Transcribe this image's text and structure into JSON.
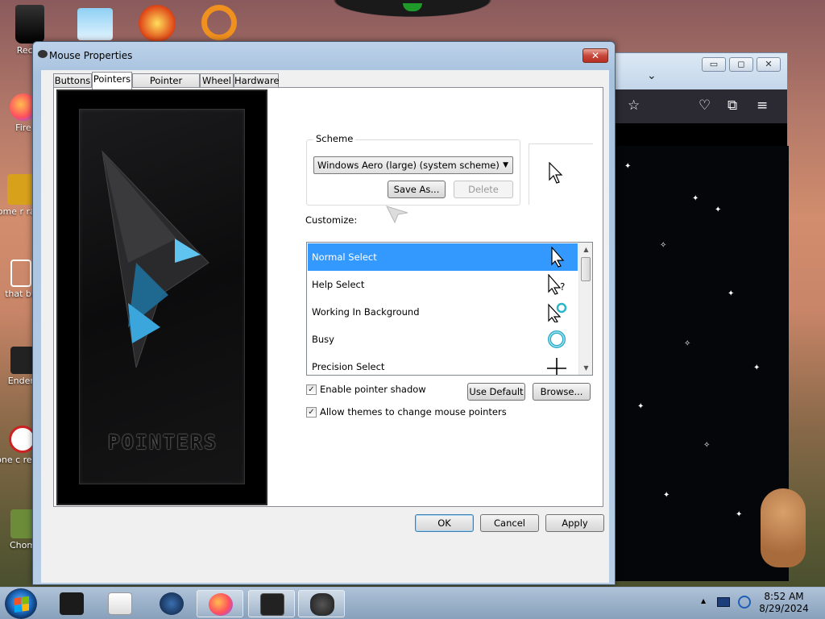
{
  "desktop": {
    "icons": [
      {
        "label": "Recyc",
        "icon": "recycle-bin-icon"
      },
      {
        "label": "Fire",
        "icon": "firefox-icon"
      },
      {
        "label": "some r ran a",
        "icon": "app-icon"
      },
      {
        "label": "that bu",
        "icon": "clipboard-icon"
      },
      {
        "label": "Enderr",
        "icon": "app-icon"
      },
      {
        "label": "none c retards",
        "icon": "app-icon"
      },
      {
        "label": "Chom",
        "icon": "app-icon"
      }
    ]
  },
  "browser": {
    "min_glyph": "▭",
    "max_glyph": "◻",
    "close_glyph": "✕",
    "chevron_glyph": "⌄",
    "toolbar_icons": [
      "star-icon",
      "pocket-icon",
      "extensions-icon",
      "menu-icon"
    ]
  },
  "dialog": {
    "title": "Mouse Properties",
    "close_glyph": "✕",
    "tabs": [
      "Buttons",
      "Pointers",
      "Pointer Options",
      "Wheel",
      "Hardware"
    ],
    "active_tab": "Pointers",
    "art_text": "POINTERS",
    "scheme": {
      "legend": "Scheme",
      "value": "Windows Aero (large) (system scheme)",
      "arrow": "▼",
      "save_as": "Save As...",
      "delete": "Delete"
    },
    "customize_label": "Customize:",
    "cursor_rows": [
      {
        "label": "Normal Select",
        "icon": "arrow-cursor-icon",
        "selected": true
      },
      {
        "label": "Help Select",
        "icon": "help-cursor-icon",
        "selected": false
      },
      {
        "label": "Working In Background",
        "icon": "working-cursor-icon",
        "selected": false
      },
      {
        "label": "Busy",
        "icon": "busy-cursor-icon",
        "selected": false
      },
      {
        "label": "Precision Select",
        "icon": "crosshair-cursor-icon",
        "selected": false
      }
    ],
    "scroll_up": "▲",
    "scroll_down": "▼",
    "enable_shadow": {
      "label": "Enable pointer shadow",
      "checked": true
    },
    "allow_themes": {
      "label": "Allow themes to change mouse pointers",
      "checked": true
    },
    "check_glyph": "✓",
    "use_default": "Use Default",
    "browse": "Browse...",
    "ok": "OK",
    "cancel": "Cancel",
    "apply": "Apply"
  },
  "taskbar": {
    "items": [
      "app-icon",
      "media-player-icon",
      "app-icon",
      "firefox-icon",
      "app-icon",
      "mouse-icon"
    ],
    "tray_arrow": "▲",
    "time": "8:52 AM",
    "date": "8/29/2024"
  },
  "colors": {
    "selection": "#3399ff",
    "dialog_frame": "#b7cde6",
    "close_red": "#c7473a",
    "taskbar": "#a7bcd6"
  }
}
